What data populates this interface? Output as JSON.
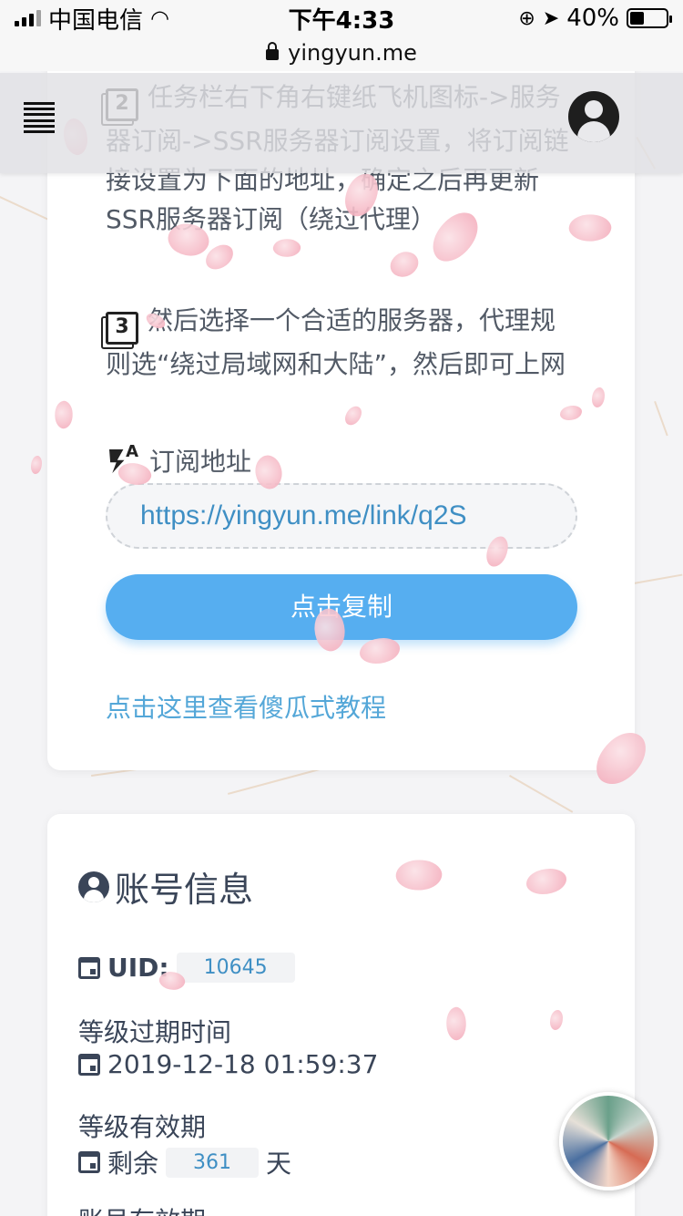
{
  "status_bar": {
    "carrier": "中国电信",
    "time": "下午4:33",
    "battery_percent": "40%",
    "battery_level": 0.4
  },
  "url_bar": {
    "domain": "yingyun.me"
  },
  "subscription_card": {
    "step2_text": "任务栏右下角右键纸飞机图标->服务器订阅->SSR服务器订阅设置，将订阅链接设置为下面的地址，确定之后再更新SSR服务器订阅（绕过代理）",
    "step3_text": "然后选择一个合适的服务器，代理规则选“绕过局域网和大陆”，然后即可上网",
    "subscription_label": "订阅地址",
    "subscription_url": "https://yingyun.me/link/q2S",
    "copy_button": "点击复制",
    "tutorial_link": "点击这里查看傻瓜式教程"
  },
  "account_card": {
    "title": "账号信息",
    "uid_label": "UID:",
    "uid_value": "10645",
    "level_expire_label": "等级过期时间",
    "level_expire_value": "2019-12-18 01:59:37",
    "level_valid_label": "等级有效期",
    "remaining_prefix": "剩余",
    "remaining_days": "361",
    "remaining_suffix": "天",
    "account_valid_label": "账号有效期"
  },
  "icons": {
    "menu": "menu-icon",
    "avatar": "user-avatar-icon",
    "step2": "filter-2-icon",
    "step3": "filter-3-icon",
    "font": "font-download-icon",
    "user_circle": "account-circle-icon",
    "calendar": "calendar-icon"
  },
  "colors": {
    "primary_button": "#56aef0",
    "link": "#54a7d8",
    "badge_text": "#3f8fc4",
    "title": "#3a4558"
  }
}
